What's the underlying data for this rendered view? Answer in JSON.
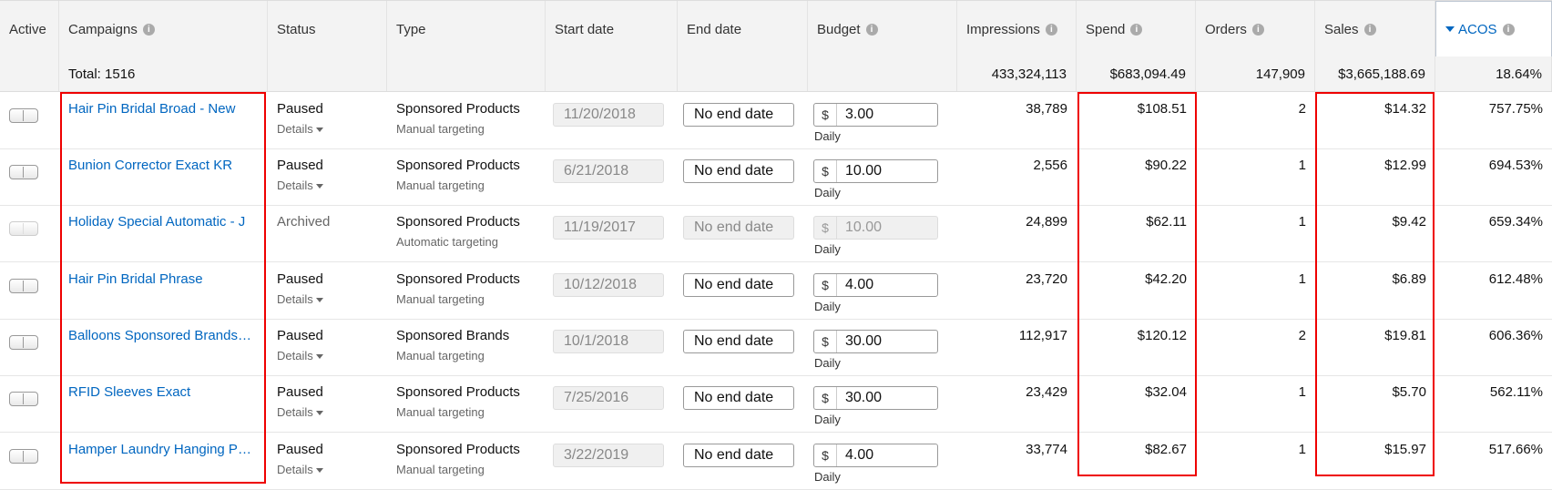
{
  "columns": {
    "active": "Active",
    "campaigns": "Campaigns",
    "status": "Status",
    "type": "Type",
    "start_date": "Start date",
    "end_date": "End date",
    "budget": "Budget",
    "impressions": "Impressions",
    "spend": "Spend",
    "orders": "Orders",
    "sales": "Sales",
    "acos": "ACOS"
  },
  "totals": {
    "label": "Total: 1516",
    "impressions": "433,324,113",
    "spend": "$683,094.49",
    "orders": "147,909",
    "sales": "$3,665,188.69",
    "acos": "18.64%"
  },
  "rows": [
    {
      "name": "Hair Pin Bridal Broad - New",
      "status": "Paused",
      "details": "Details",
      "type": "Sponsored Products",
      "targeting": "Manual targeting",
      "start": "11/20/2018",
      "end": "No end date",
      "currency": "$",
      "budget": "3.00",
      "budget_type": "Daily",
      "impressions": "38,789",
      "spend": "$108.51",
      "orders": "2",
      "sales": "$14.32",
      "acos": "757.75%"
    },
    {
      "name": "Bunion Corrector Exact KR",
      "status": "Paused",
      "details": "Details",
      "type": "Sponsored Products",
      "targeting": "Manual targeting",
      "start": "6/21/2018",
      "end": "No end date",
      "currency": "$",
      "budget": "10.00",
      "budget_type": "Daily",
      "impressions": "2,556",
      "spend": "$90.22",
      "orders": "1",
      "sales": "$12.99",
      "acos": "694.53%"
    },
    {
      "name": "Holiday Special Automatic - J",
      "status": "Archived",
      "details": "",
      "type": "Sponsored Products",
      "targeting": "Automatic targeting",
      "start": "11/19/2017",
      "end": "No end date",
      "currency": "$",
      "budget": "10.00",
      "budget_type": "Daily",
      "impressions": "24,899",
      "spend": "$62.11",
      "orders": "1",
      "sales": "$9.42",
      "acos": "659.34%"
    },
    {
      "name": "Hair Pin Bridal Phrase",
      "status": "Paused",
      "details": "Details",
      "type": "Sponsored Products",
      "targeting": "Manual targeting",
      "start": "10/12/2018",
      "end": "No end date",
      "currency": "$",
      "budget": "4.00",
      "budget_type": "Daily",
      "impressions": "23,720",
      "spend": "$42.20",
      "orders": "1",
      "sales": "$6.89",
      "acos": "612.48%"
    },
    {
      "name": "Balloons Sponsored Brands …",
      "status": "Paused",
      "details": "Details",
      "type": "Sponsored Brands",
      "targeting": "Manual targeting",
      "start": "10/1/2018",
      "end": "No end date",
      "currency": "$",
      "budget": "30.00",
      "budget_type": "Daily",
      "impressions": "112,917",
      "spend": "$120.12",
      "orders": "2",
      "sales": "$19.81",
      "acos": "606.36%"
    },
    {
      "name": "RFID Sleeves Exact",
      "status": "Paused",
      "details": "Details",
      "type": "Sponsored Products",
      "targeting": "Manual targeting",
      "start": "7/25/2016",
      "end": "No end date",
      "currency": "$",
      "budget": "30.00",
      "budget_type": "Daily",
      "impressions": "23,429",
      "spend": "$32.04",
      "orders": "1",
      "sales": "$5.70",
      "acos": "562.11%"
    },
    {
      "name": "Hamper Laundry Hanging P…",
      "status": "Paused",
      "details": "Details",
      "type": "Sponsored Products",
      "targeting": "Manual targeting",
      "start": "3/22/2019",
      "end": "No end date",
      "currency": "$",
      "budget": "4.00",
      "budget_type": "Daily",
      "impressions": "33,774",
      "spend": "$82.67",
      "orders": "1",
      "sales": "$15.97",
      "acos": "517.66%"
    }
  ],
  "colors": {
    "link": "#0066c0",
    "highlight": "#e00000",
    "header_bg": "#f3f3f3"
  },
  "icons": {
    "info": "info-circle-icon",
    "sort": "sort-desc-icon",
    "details": "chevron-down-icon"
  }
}
